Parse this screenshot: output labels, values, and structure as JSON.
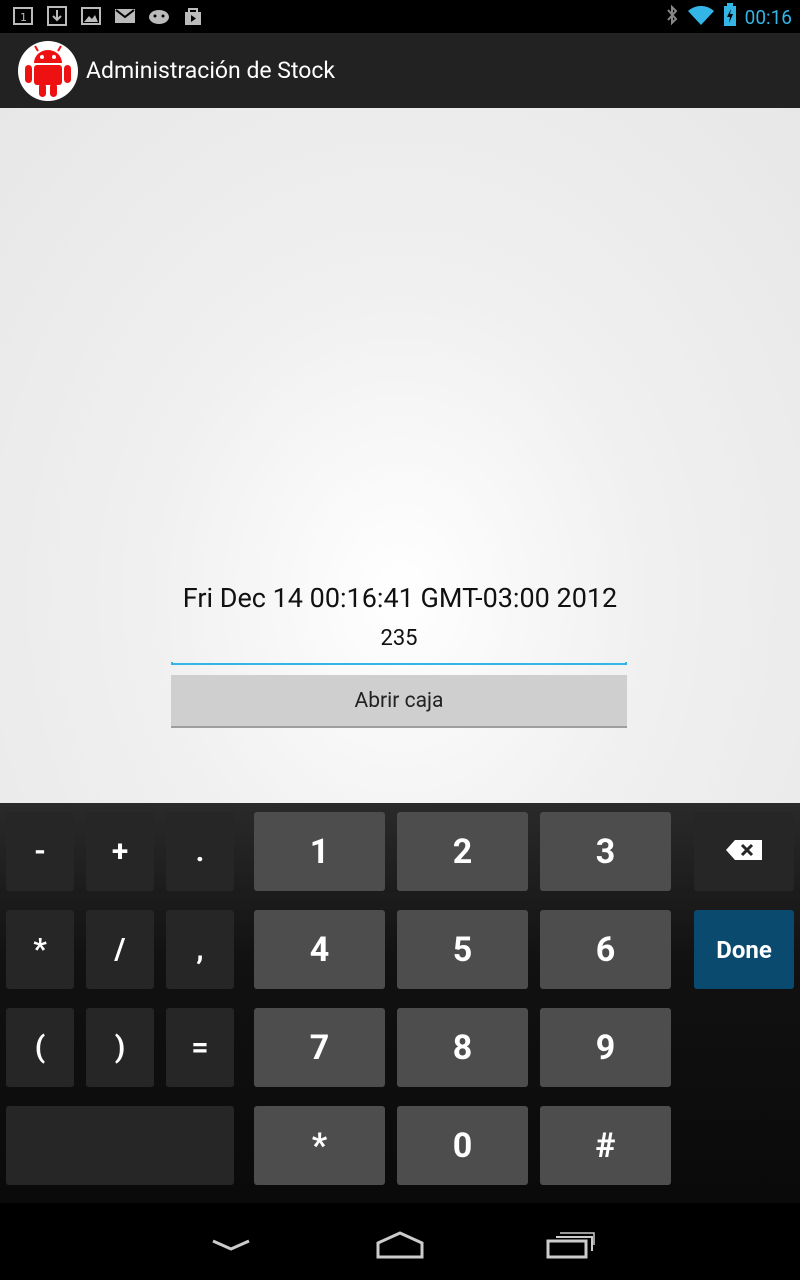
{
  "status_bar": {
    "icons_left": [
      "sim-notification-icon",
      "download-icon",
      "image-icon",
      "gmail-icon",
      "android-robot-icon",
      "play-store-icon"
    ],
    "icons_right": [
      "bluetooth-icon",
      "wifi-icon",
      "battery-charging-icon"
    ],
    "time": "00:16",
    "accent_color": "#33b5e5"
  },
  "action_bar": {
    "title": "Administración de Stock",
    "icon": "android-app-icon"
  },
  "main": {
    "date_text": "Fri Dec 14 00:16:41 GMT-03:00 2012",
    "amount_value": "235",
    "open_button_label": "Abrir caja"
  },
  "keyboard": {
    "row1": {
      "s1": "-",
      "s2": "+",
      "s3": ".",
      "n1": "1",
      "n2": "2",
      "n3": "3"
    },
    "row2": {
      "s1": "*",
      "s2": "/",
      "s3": ",",
      "n1": "4",
      "n2": "5",
      "n3": "6",
      "done": "Done"
    },
    "row3": {
      "s1": "(",
      "s2": ")",
      "s3": "=",
      "n1": "7",
      "n2": "8",
      "n3": "9"
    },
    "row4": {
      "n1": "*",
      "n2": "0",
      "n3": "#"
    },
    "backspace_icon": "backspace-icon",
    "done_color": "#0b4a6f"
  },
  "nav_bar": {
    "icons": [
      "back-icon",
      "home-icon",
      "recent-apps-icon"
    ]
  }
}
